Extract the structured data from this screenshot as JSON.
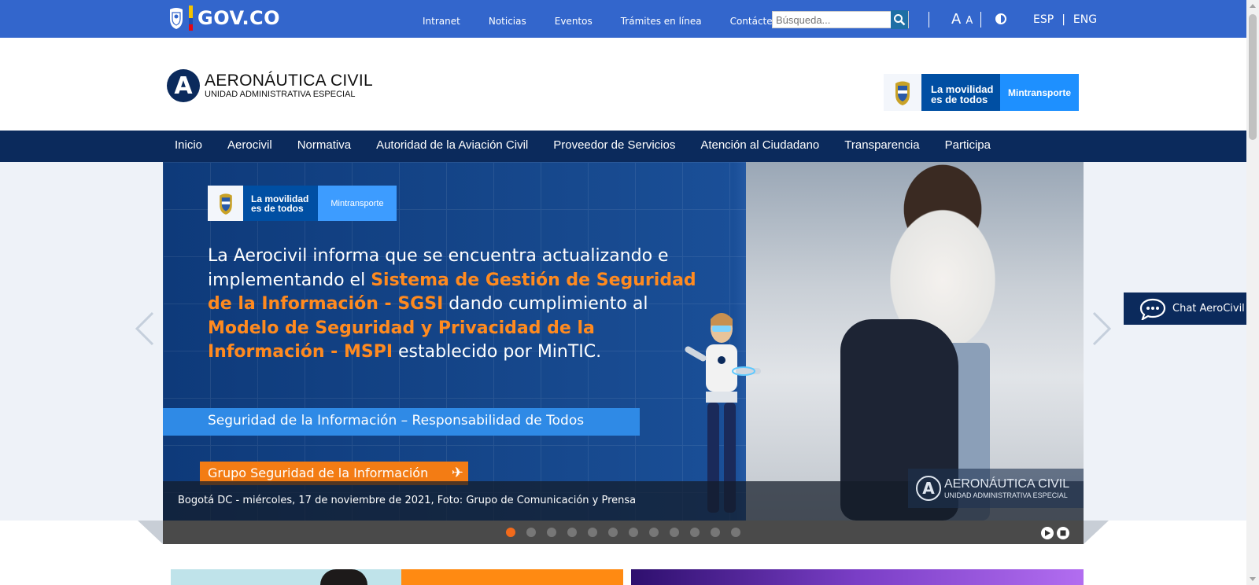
{
  "govbar": {
    "brand": "GOV.CO",
    "links": [
      "Intranet",
      "Noticias",
      "Eventos",
      "Trámites en línea",
      "Contáctenos"
    ],
    "search_placeholder": "Búsqueda...",
    "font_large": "A",
    "font_small": "A",
    "lang_esp": "ESP",
    "lang_sep": "|",
    "lang_eng": "ENG"
  },
  "header": {
    "org_name": "AERONÁUTICA CIVIL",
    "org_sub": "UNIDAD ADMINISTRATIVA ESPECIAL",
    "emblem_letter": "A",
    "movilidad": "La movilidad es de todos",
    "ministry": "Mintransporte"
  },
  "mainnav": {
    "items": [
      "Inicio",
      "Aerocivil",
      "Normativa",
      "Autoridad de la Aviación Civil",
      "Proveedor de Servicios",
      "Atención al Ciudadano",
      "Transparencia",
      "Participa"
    ]
  },
  "slide": {
    "badge_movilidad": "La movilidad es de todos",
    "badge_ministry": "Mintransporte",
    "headline_1": "La Aerocivil informa que se encuentra actualizando e implementando el ",
    "headline_hl1": "Sistema de Gestión de Seguridad de la Información - SGSI",
    "headline_2": " dando cumplimiento al ",
    "headline_hl2": "Modelo de Seguridad y Privacidad de la Información - MSPI",
    "headline_3": " establecido por MinTIC.",
    "strip": "Seguridad de la Información – Responsabilidad de Todos",
    "grupo": "Grupo Seguridad de la Información",
    "caption": "Bogotá DC - miércoles, 17 de noviembre de 2021, Foto: Grupo de Comunicación y Prensa",
    "watermark_name": "AERONÁUTICA CIVIL",
    "watermark_sub": "UNIDAD ADMINISTRATIVA ESPECIAL",
    "dot_count": 12,
    "active_dot": 1
  },
  "chat": {
    "label": "Chat AeroCivil"
  },
  "colors": {
    "gov_blue": "#3366cc",
    "navy": "#0b2a5c",
    "orange": "#f37c14",
    "strip_blue": "#2f8ae6"
  }
}
